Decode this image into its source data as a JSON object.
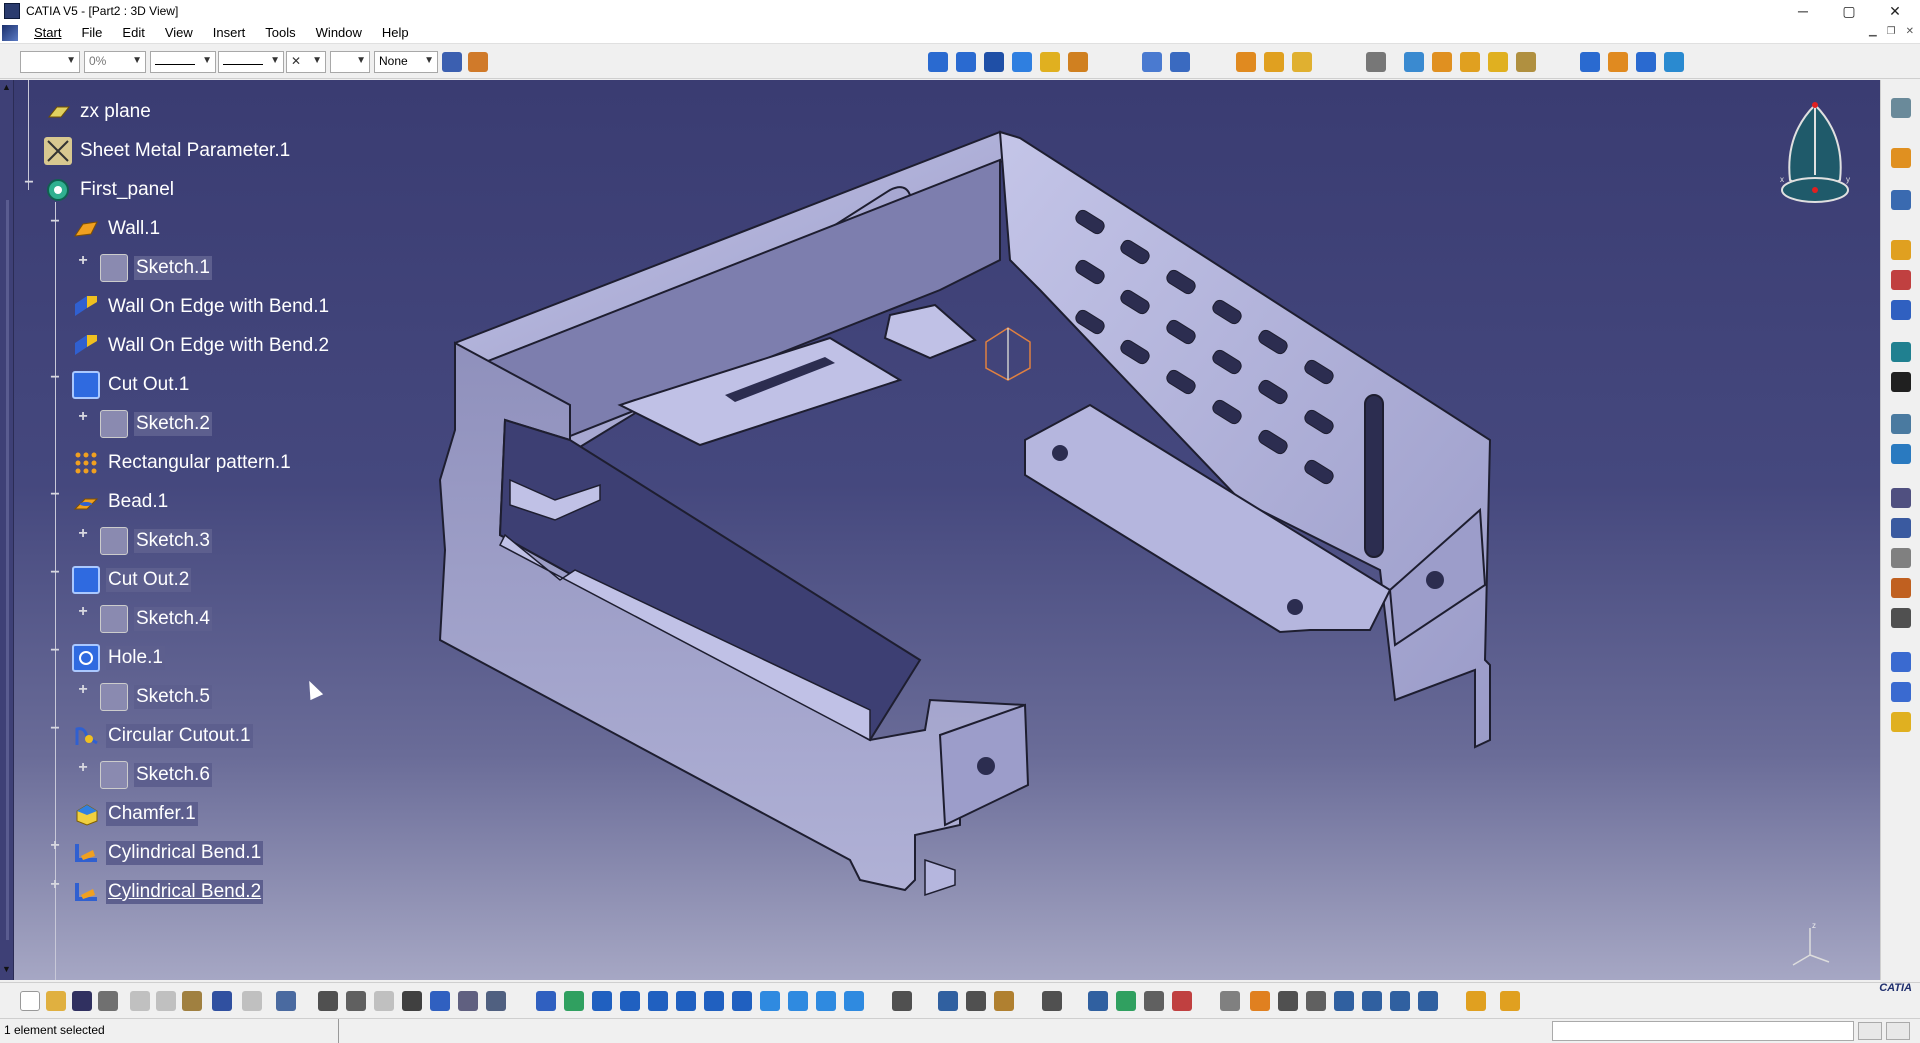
{
  "window": {
    "title": "CATIA V5 - [Part2 : 3D View]",
    "minimize": "─",
    "maximize": "▢",
    "close": "✕"
  },
  "menu": {
    "items": [
      "Start",
      "File",
      "Edit",
      "View",
      "Insert",
      "Tools",
      "Window",
      "Help"
    ]
  },
  "toolbar_top": {
    "opacity_value": "0%",
    "layer_value": "None"
  },
  "tree": {
    "nodes": [
      {
        "label": "zx plane",
        "icon": "plane-icon",
        "level": 0
      },
      {
        "label": "Sheet Metal Parameter.1",
        "icon": "sheet-metal-parameters-icon",
        "level": 0
      },
      {
        "label": "First_panel",
        "icon": "body-icon",
        "level": 0
      },
      {
        "label": "Wall.1",
        "icon": "wall-icon",
        "level": 1
      },
      {
        "label": "Sketch.1",
        "icon": "sketch-icon",
        "level": 2
      },
      {
        "label": "Wall On Edge with Bend.1",
        "icon": "wall-on-edge-icon",
        "level": 1
      },
      {
        "label": "Wall On Edge with Bend.2",
        "icon": "wall-on-edge-icon",
        "level": 1
      },
      {
        "label": "Cut Out.1",
        "icon": "cutout-icon",
        "level": 1
      },
      {
        "label": "Sketch.2",
        "icon": "sketch-icon",
        "level": 2
      },
      {
        "label": "Rectangular pattern.1",
        "icon": "rectangular-pattern-icon",
        "level": 1
      },
      {
        "label": "Bead.1",
        "icon": "bead-icon",
        "level": 1
      },
      {
        "label": "Sketch.3",
        "icon": "sketch-icon",
        "level": 2
      },
      {
        "label": "Cut Out.2",
        "icon": "cutout-icon",
        "level": 1
      },
      {
        "label": "Sketch.4",
        "icon": "sketch-icon",
        "level": 2
      },
      {
        "label": "Hole.1",
        "icon": "hole-icon",
        "level": 1
      },
      {
        "label": "Sketch.5",
        "icon": "sketch-icon",
        "level": 2
      },
      {
        "label": "Circular Cutout.1",
        "icon": "circular-cutout-icon",
        "level": 1
      },
      {
        "label": "Sketch.6",
        "icon": "sketch-icon",
        "level": 2
      },
      {
        "label": "Chamfer.1",
        "icon": "chamfer-icon",
        "level": 1
      },
      {
        "label": "Cylindrical Bend.1",
        "icon": "cylindrical-bend-icon",
        "level": 1
      },
      {
        "label": "Cylindrical Bend.2",
        "icon": "cylindrical-bend-icon",
        "level": 1
      }
    ]
  },
  "compass": {
    "x_label": "x",
    "y_label": "y",
    "z_label": "z"
  },
  "status": {
    "message": "1 element selected"
  },
  "logo": "CATIA",
  "colors": {
    "viewport_top": "#3a3c72",
    "viewport_bottom": "#a6a7c4",
    "part_face": "#b8b9e0",
    "part_edge": "#1e1e30",
    "tree_text": "#ffffff",
    "highlight": "#5d5f8e"
  }
}
